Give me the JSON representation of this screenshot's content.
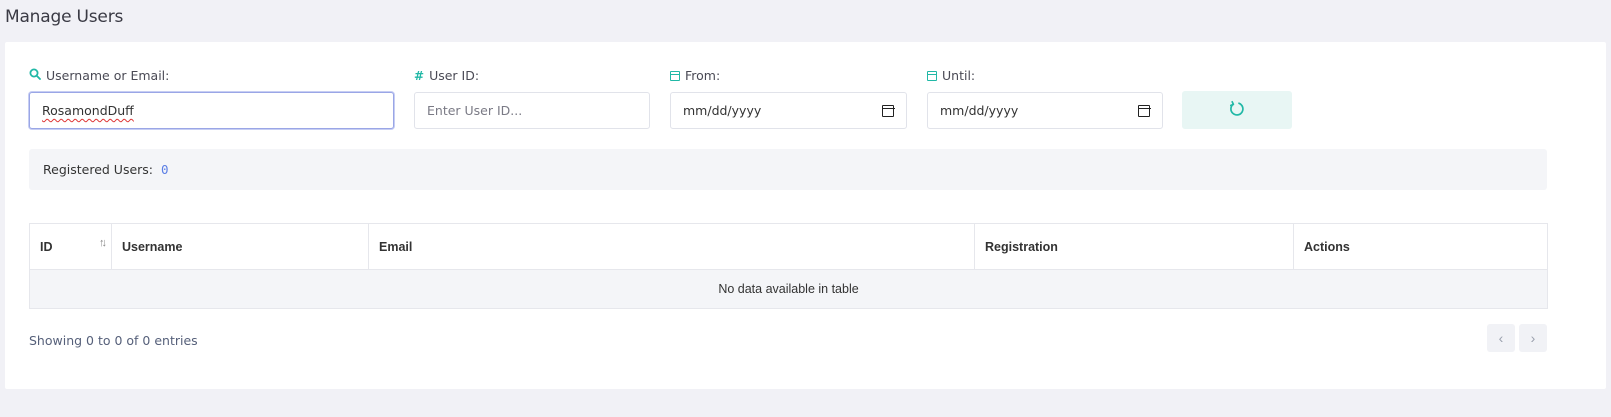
{
  "page": {
    "title": "Manage Users"
  },
  "filters": {
    "username": {
      "label": "Username or Email:",
      "value": "RosamondDuff",
      "icon": "search-icon"
    },
    "user_id": {
      "label": "User ID:",
      "placeholder": "Enter User ID...",
      "icon": "hash-icon"
    },
    "from": {
      "label": "From:",
      "value": "mm/dd/yyyy",
      "icon": "calendar-icon"
    },
    "until": {
      "label": "Until:",
      "value": "mm/dd/yyyy",
      "icon": "calendar-icon"
    },
    "reset_icon": "refresh-icon"
  },
  "summary": {
    "label": "Registered Users:",
    "count": "0"
  },
  "table": {
    "columns": [
      "ID",
      "Username",
      "Email",
      "Registration",
      "Actions"
    ],
    "empty_message": "No data available in table"
  },
  "footer": {
    "info": "Showing 0 to 0 of 0 entries",
    "prev": "‹",
    "next": "›"
  },
  "colors": {
    "accent": "#21b8a6",
    "count": "#5b7ee5",
    "background": "#f1f1f6"
  }
}
